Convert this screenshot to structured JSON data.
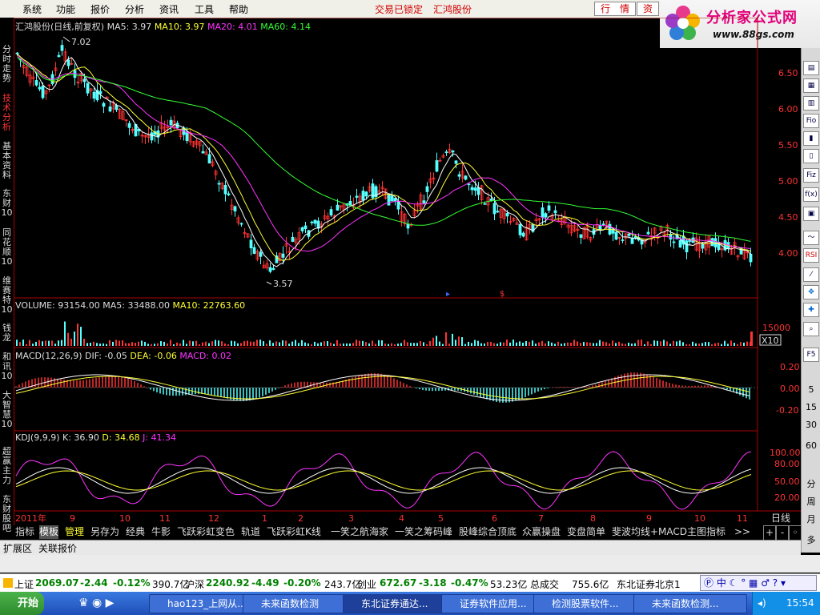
{
  "menu": {
    "items": [
      "系统",
      "功能",
      "报价",
      "分析",
      "资讯",
      "工具",
      "帮助"
    ],
    "lock_status": "交易已锁定",
    "stock_name": "汇鸿股份",
    "tab_market": "行　情",
    "tab_info": "资"
  },
  "logo": {
    "title": "分析家公式网",
    "url": "www.88gs.com"
  },
  "left_tabs": [
    "分时走势",
    "技术分析",
    "基本资料",
    "东财10",
    "同花顺10",
    "维赛特10",
    "钱龙",
    "和讯10",
    "大智慧10",
    "超赢主力",
    "东财股吧"
  ],
  "main_chart": {
    "header_title": "汇鸿股份(日线,前复权)",
    "ma5": "MA5: 3.97",
    "ma10": "MA10: 3.97",
    "ma20": "MA20: 4.01",
    "ma60": "MA60: 4.14",
    "high_label": "7.02",
    "low_label": "3.57",
    "price_ticks": [
      "6.50",
      "6.00",
      "5.50",
      "5.00",
      "4.50",
      "4.00"
    ]
  },
  "volume_panel": {
    "label": "VOLUME: 93154.00",
    "ma5": "MA5: 33488.00",
    "ma10": "MA10: 22763.60",
    "tick": "15000",
    "unit": "X10"
  },
  "macd_panel": {
    "label": "MACD(12,26,9)",
    "dif": "DIF: -0.05",
    "dea": "DEA: -0.06",
    "macd": "MACD: 0.02",
    "ticks": [
      "0.20",
      "0.00",
      "-0.20"
    ]
  },
  "kdj_panel": {
    "label": "KDJ(9,9,9)",
    "k": "K: 36.90",
    "d": "D: 34.68",
    "j": "J: 41.34",
    "ticks": [
      "100.00",
      "80.00",
      "50.00",
      "20.00"
    ]
  },
  "date_axis": [
    "2011年",
    "9",
    "10",
    "11",
    "12",
    "1",
    "2",
    "3",
    "4",
    "5",
    "6",
    "7",
    "8",
    "9",
    "10",
    "11"
  ],
  "period_label": "日线",
  "indicator_tabs": [
    "指标",
    "模板",
    "管理",
    "另存为",
    "经典",
    "牛影",
    "飞跃彩虹变色",
    "轨道",
    "飞跃彩虹K线",
    "一笑之航海家",
    "一笑之筹码峰",
    "股峰综合顶底",
    "众赢操盘",
    "变盘简单",
    "斐波均线+MACD主图指标"
  ],
  "more_tabs": ">>",
  "ext_tabs": [
    "扩展区",
    "关联报价"
  ],
  "right_tools": [
    "Fio",
    "Fiz",
    "f(x)",
    "RSI",
    "F5"
  ],
  "right_numbers": [
    "5",
    "15",
    "30",
    "60",
    "分",
    "周",
    "月",
    "多"
  ],
  "ticker": {
    "sh_label": "上证",
    "sh_val": "2069.07",
    "sh_chg": "-2.44",
    "sh_pct": "-0.12%",
    "sh_amt": "390.7亿",
    "sz_label": "沪深",
    "sz_val": "2240.92",
    "sz_chg": "-4.49",
    "sz_pct": "-0.20%",
    "sz_amt": "243.7亿",
    "cy_label": "创业",
    "cy_val": "672.67",
    "cy_chg": "-3.18",
    "cy_pct": "-0.47%",
    "cy_amt": "53.23亿",
    "deal_label": "总成交",
    "deal_val": "755.6亿",
    "server": "东北证券北京1"
  },
  "taskbar": {
    "start": "开始",
    "tasks": [
      "hao123_上网从...",
      "未来函数检测",
      "东北证券通达...",
      "证券软件应用...",
      "检测股票软件...",
      "未来函数检测..."
    ],
    "clock": "15:54",
    "ime": "中"
  }
}
